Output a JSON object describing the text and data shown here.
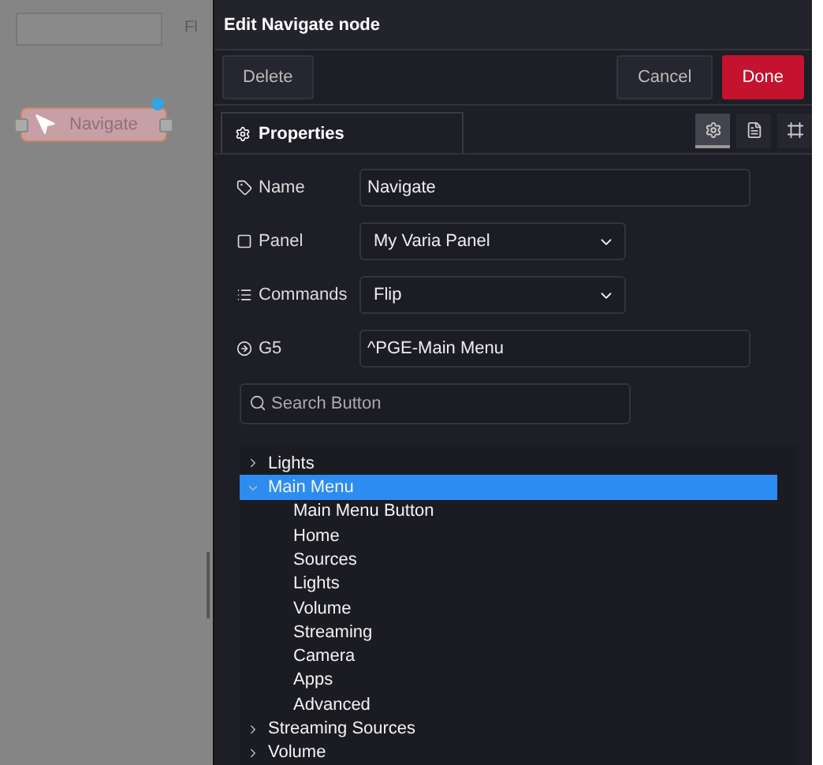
{
  "canvas": {
    "workspace_tab": "Fl",
    "node": {
      "label": "Navigate",
      "changed": true
    }
  },
  "editor": {
    "title": "Edit Navigate node",
    "buttons": {
      "delete": "Delete",
      "cancel": "Cancel",
      "done": "Done"
    },
    "tab": {
      "label": "Properties",
      "selected": true
    },
    "icon_tabs": [
      {
        "kind": "settings",
        "selected": true
      },
      {
        "kind": "description",
        "selected": false
      },
      {
        "kind": "appearance",
        "selected": false
      }
    ],
    "fields": [
      {
        "kind": "text",
        "label": "Name",
        "value": "Navigate"
      },
      {
        "kind": "select",
        "label": "Panel",
        "value": "My Varia Panel"
      },
      {
        "kind": "select",
        "label": "Commands",
        "value": "Flip"
      },
      {
        "kind": "text",
        "label": "G5",
        "value": "^PGE-Main Menu"
      }
    ],
    "search": {
      "placeholder": "Search Button"
    },
    "tree": [
      {
        "label": "Lights",
        "expanded": false,
        "selected": false
      },
      {
        "label": "Main Menu",
        "expanded": true,
        "selected": true,
        "children": [
          {
            "label": "Main Menu Button",
            "selected": false
          },
          {
            "label": "Home",
            "selected": false
          },
          {
            "label": "Sources",
            "selected": false
          },
          {
            "label": "Lights",
            "selected": false
          },
          {
            "label": "Volume",
            "selected": false
          },
          {
            "label": "Streaming",
            "selected": false
          },
          {
            "label": "Camera",
            "selected": false
          },
          {
            "label": "Apps",
            "selected": false
          },
          {
            "label": "Advanced",
            "selected": false
          }
        ]
      },
      {
        "label": "Streaming Sources",
        "expanded": false,
        "selected": false
      },
      {
        "label": "Volume",
        "expanded": false,
        "selected": false
      }
    ]
  }
}
